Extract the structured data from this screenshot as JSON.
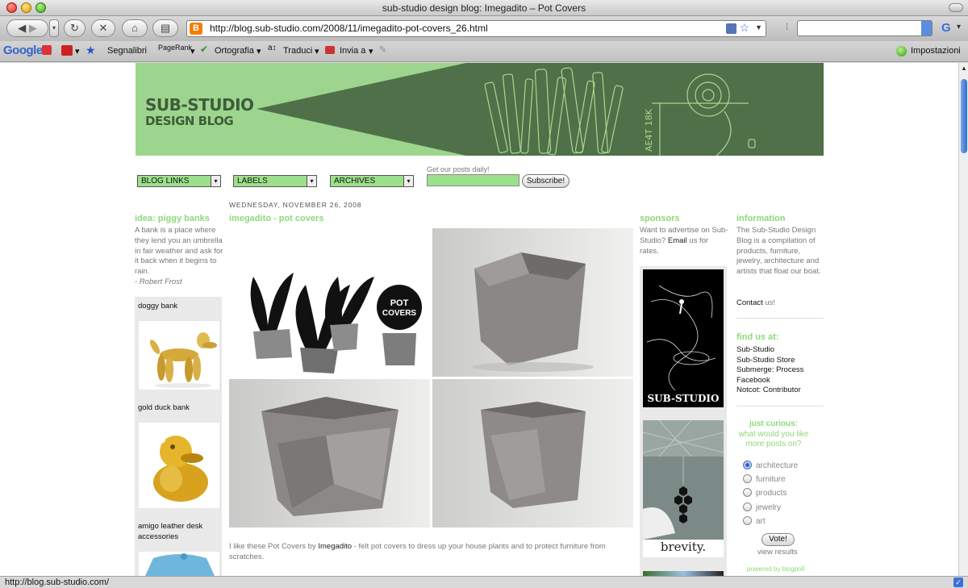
{
  "window": {
    "title": "sub-studio design blog: Imegadito – Pot Covers"
  },
  "nav": {
    "url": "http://blog.sub-studio.com/2008/11/imegadito-pot-covers_26.html",
    "back_icon": "back-arrow-icon",
    "forward_icon": "forward-arrow-icon"
  },
  "toolbar": {
    "google": "Google",
    "bookmarks": "Segnalibri",
    "pagerank": "PageRank",
    "spelling": "Ortografia",
    "translate": "Traduci",
    "send": "Invia a",
    "settings": "Impostazioni"
  },
  "status": {
    "url": "http://blog.sub-studio.com/"
  },
  "banner": {
    "line1": "SUB-STUDIO",
    "line2": "DESIGN BLOG"
  },
  "menus": {
    "blog_links": "BLOG LINKS",
    "labels": "LABELS",
    "archives": "ARCHIVES",
    "get_posts": "Get our posts daily!",
    "subscribe": "Subscribe!"
  },
  "left": {
    "idea_title": "idea: piggy banks",
    "idea_text": "A bank is a place where they lend you an umbrella in fair weather and ask for it back when it begins to rain.",
    "idea_author": "- Robert Frost",
    "items": [
      {
        "label": "doggy bank"
      },
      {
        "label": "gold duck bank"
      },
      {
        "label": "amigo leather desk accessories"
      }
    ]
  },
  "post": {
    "date": "WEDNESDAY, NOVEMBER 26, 2008",
    "title": "imegadito - pot covers",
    "pot_covers_label_1": "POT",
    "pot_covers_label_2": "COVERS",
    "text_pre": "I like these Pot Covers by ",
    "text_link": "Imegadito",
    "text_post": " - felt pot covers to dress up your house plants and to protect furniture from scratches."
  },
  "sponsors": {
    "title": "sponsors",
    "text_pre": "Want to advertise on Sub-Studio? ",
    "email": "Email",
    "text_post": " us for rates.",
    "ad1": "SUB-STUDIO",
    "ad2": "brevity."
  },
  "right": {
    "info_title": "information",
    "info_text": "The Sub-Studio Design Blog is a compilation of products, furniture, jewelry, architecture and artists that float our boat.",
    "contact": "Contact",
    "contact_post": " us!",
    "find_title": "find us at:",
    "find_links": [
      "Sub-Studio",
      "Sub-Studio Store",
      "Submerge: Process",
      "Facebook",
      "Notcot: Contributor"
    ],
    "curious_title": "just curious:",
    "curious_sub": "what would you like more posts on?",
    "poll_options": [
      "architecture",
      "furniture",
      "products",
      "jewelry",
      "art"
    ],
    "vote": "Vote!",
    "view_results": "view results",
    "powered": "powered by blogpoll"
  },
  "colors": {
    "accent_green": "#8ed879",
    "banner_green": "#9dd58e",
    "banner_dark": "#4f7048"
  }
}
